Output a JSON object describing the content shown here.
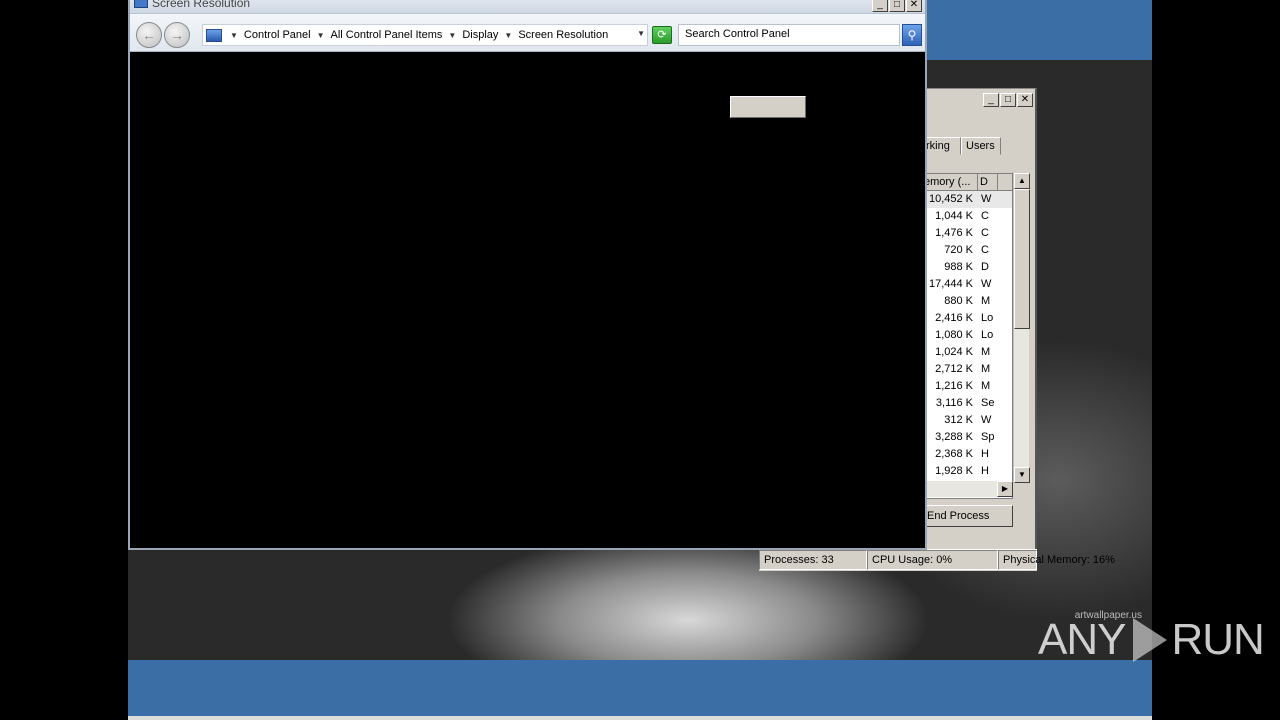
{
  "screen_resolution_window": {
    "title": "Screen Resolution",
    "breadcrumbs": [
      "Control Panel",
      "All Control Panel Items",
      "Display",
      "Screen Resolution"
    ],
    "search_placeholder": "Search Control Panel",
    "title_buttons": {
      "minimize": "_",
      "maximize": "□",
      "close": "✕"
    },
    "nav": {
      "back": "←",
      "forward": "→"
    },
    "refresh_glyph": "⟳",
    "search_glyph": "⚲"
  },
  "task_manager": {
    "title_buttons": {
      "minimize": "_",
      "maximize": "□",
      "close": "✕"
    },
    "tabs": [
      "rking",
      "Users"
    ],
    "columns": [
      "emory (...",
      "D"
    ],
    "rows": [
      {
        "mem": "10,452 K",
        "desc": "W"
      },
      {
        "mem": "1,044 K",
        "desc": "C"
      },
      {
        "mem": "1,476 K",
        "desc": "C"
      },
      {
        "mem": "720 K",
        "desc": "C"
      },
      {
        "mem": "988 K",
        "desc": "D"
      },
      {
        "mem": "17,444 K",
        "desc": "W"
      },
      {
        "mem": "880 K",
        "desc": "M"
      },
      {
        "mem": "2,416 K",
        "desc": "Lo"
      },
      {
        "mem": "1,080 K",
        "desc": "Lo"
      },
      {
        "mem": "1,024 K",
        "desc": "M"
      },
      {
        "mem": "2,712 K",
        "desc": "M"
      },
      {
        "mem": "1,216 K",
        "desc": "M"
      },
      {
        "mem": "3,116 K",
        "desc": "Se"
      },
      {
        "mem": "312 K",
        "desc": "W"
      },
      {
        "mem": "3,288 K",
        "desc": "Sp"
      },
      {
        "mem": "2,368 K",
        "desc": "H"
      },
      {
        "mem": "1,928 K",
        "desc": "H"
      }
    ],
    "end_process": "End Process",
    "status": {
      "processes": "Processes: 33",
      "cpu": "CPU Usage: 0%",
      "memory": "Physical Memory: 16%"
    }
  },
  "wallpaper": {
    "credit": "artwallpaper.us"
  },
  "watermark": {
    "left": "ANY",
    "right": "RUN"
  },
  "colors": {
    "desktop_blue": "#3b6ea5",
    "window_gray": "#d4d0c8"
  }
}
